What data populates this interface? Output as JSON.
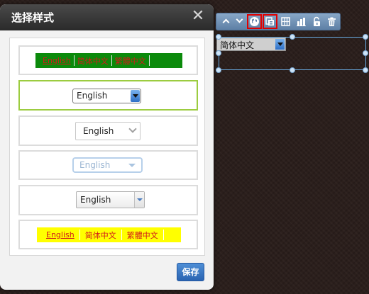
{
  "dialog": {
    "title": "选择样式",
    "close_icon": "close-icon",
    "save_label": "保存",
    "options": [
      {
        "style": "link-bar-green",
        "links": [
          "English",
          "简体中文",
          "繁體中文"
        ],
        "bar_color": "#0b8a0b",
        "link_color": "#d21a1a"
      },
      {
        "style": "select-blue-arrow",
        "value": "English",
        "selected": true
      },
      {
        "style": "select-chevron",
        "value": "English"
      },
      {
        "style": "select-rounded-light",
        "value": "English"
      },
      {
        "style": "select-split-button",
        "value": "English"
      },
      {
        "style": "link-bar-yellow",
        "links": [
          "English",
          "简体中文",
          "繁體中文"
        ],
        "bar_color": "#ffff00",
        "link_color": "#d21a1a"
      }
    ],
    "selected_border_color": "#9ccc40"
  },
  "toolbar": {
    "buttons": [
      {
        "icon": "move-up-icon"
      },
      {
        "icon": "move-down-icon"
      },
      {
        "icon": "globe-icon",
        "highlighted": true
      },
      {
        "icon": "style-icon",
        "highlighted": true
      },
      {
        "icon": "grid-icon"
      },
      {
        "icon": "bar-chart-icon"
      },
      {
        "icon": "unlock-icon"
      },
      {
        "icon": "trash-icon"
      }
    ],
    "highlight_color": "#e00000"
  },
  "canvas": {
    "language_select_value": "简体中文"
  },
  "colors": {
    "accent": "#2a64b2",
    "background": "#2b1f1c"
  }
}
